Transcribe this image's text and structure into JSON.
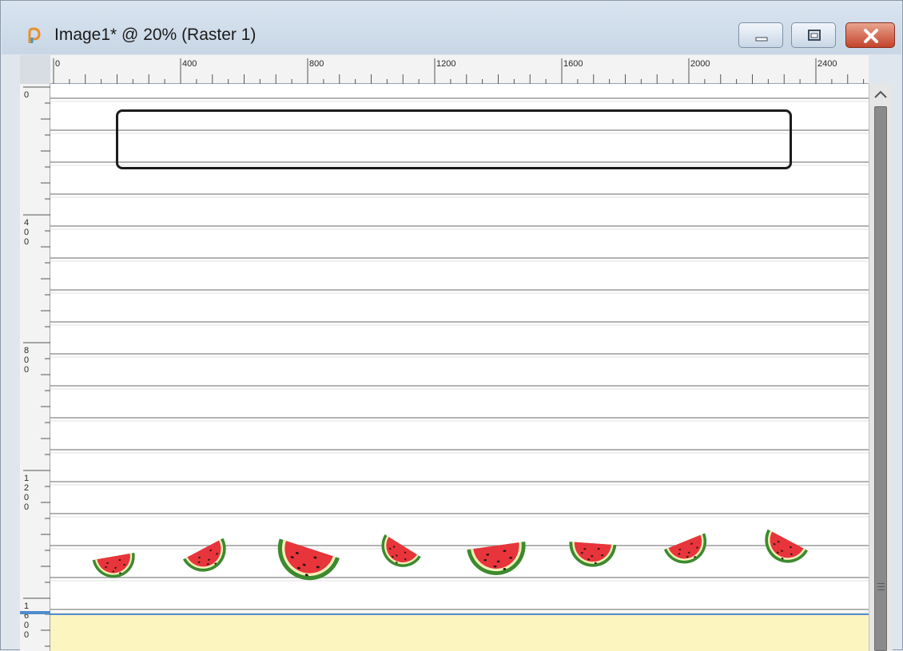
{
  "window": {
    "title": "Image1* @  20% (Raster 1)",
    "buttons": {
      "minimize": "minimize",
      "maximize": "maximize",
      "close": "close"
    }
  },
  "ruler_horizontal": {
    "labels": [
      "0",
      "400",
      "800",
      "1200",
      "1600",
      "2000",
      "2400"
    ]
  },
  "ruler_vertical": {
    "labels": [
      "0",
      "400",
      "800",
      "1200",
      "1600"
    ]
  },
  "canvas": {
    "zoom": "20%",
    "layer": "Raster 1",
    "stickers": [
      "watermelon-slice",
      "watermelon-slice",
      "watermelon-slice",
      "watermelon-slice",
      "watermelon-slice",
      "watermelon-slice",
      "watermelon-slice",
      "watermelon-slice"
    ]
  },
  "colors": {
    "canvas_bg": "#ffffff",
    "rule_line": "#9a9a9a",
    "bottom_band": "#fdf5c0",
    "selection_line": "#4f8ccc",
    "melon_flesh": "#e8343b",
    "melon_rind": "#3c8a2e"
  }
}
